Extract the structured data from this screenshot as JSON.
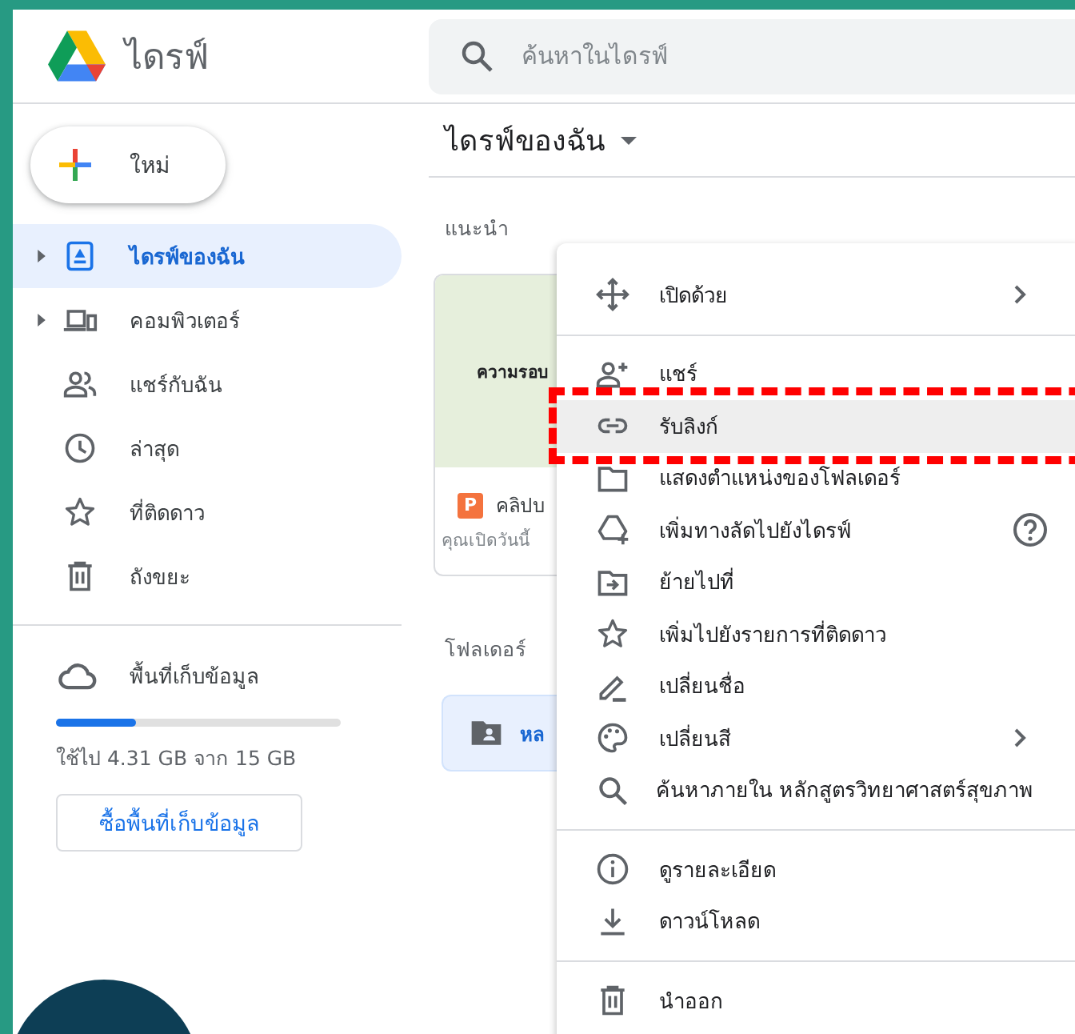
{
  "header": {
    "product_name": "ไดรฟ์",
    "search": {
      "placeholder": "ค้นหาในไดรฟ์"
    }
  },
  "sidebar": {
    "new_button": "ใหม่",
    "items": [
      {
        "label": "ไดรฟ์ของฉัน",
        "kind": "drive",
        "expandable": true,
        "selected": true
      },
      {
        "label": "คอมพิวเตอร์",
        "kind": "computer",
        "expandable": true,
        "selected": false
      },
      {
        "label": "แชร์กับฉัน",
        "kind": "shared",
        "expandable": false,
        "selected": false
      },
      {
        "label": "ล่าสุด",
        "kind": "recent",
        "expandable": false,
        "selected": false
      },
      {
        "label": "ที่ติดดาว",
        "kind": "starred",
        "expandable": false,
        "selected": false
      },
      {
        "label": "ถังขยะ",
        "kind": "trash",
        "expandable": false,
        "selected": false
      }
    ],
    "storage": {
      "label": "พื้นที่เก็บข้อมูล",
      "level": 0.28,
      "usage": "ใช้ไป 4.31 GB จาก 15 GB",
      "buy_button": "ซื้อพื้นที่เก็บข้อมูล"
    }
  },
  "main": {
    "title": "ไดรฟ์ของฉัน",
    "suggested_heading": "แนะนำ",
    "suggested_card": {
      "preview_text": "ความรอบ",
      "file_type": "P",
      "file_name": "คลิปบ",
      "subtitle": "คุณเปิดวันนี้"
    },
    "folders_heading": "โฟลเดอร์",
    "folders": [
      {
        "name": "หล"
      }
    ]
  },
  "context_menu": {
    "sections": [
      [
        {
          "label": "เปิดด้วย",
          "kind": "open_with",
          "submenu": true,
          "help": false,
          "highlighted": false,
          "annotated": false
        }
      ],
      [
        {
          "label": "แชร์",
          "kind": "share",
          "submenu": false,
          "help": false,
          "highlighted": false,
          "annotated": false
        },
        {
          "label": "รับลิงก์",
          "kind": "link",
          "submenu": false,
          "help": false,
          "highlighted": true,
          "annotated": true
        },
        {
          "label": "แสดงตำแหน่งของโฟลเดอร์",
          "kind": "folder",
          "submenu": false,
          "help": false,
          "highlighted": false,
          "annotated": false
        },
        {
          "label": "เพิ่มทางลัดไปยังไดรฟ์",
          "kind": "shortcut",
          "submenu": false,
          "help": true,
          "highlighted": false,
          "annotated": false
        },
        {
          "label": "ย้ายไปที่",
          "kind": "move",
          "submenu": false,
          "help": false,
          "highlighted": false,
          "annotated": false
        },
        {
          "label": "เพิ่มไปยังรายการที่ติดดาว",
          "kind": "star",
          "submenu": false,
          "help": false,
          "highlighted": false,
          "annotated": false
        },
        {
          "label": "เปลี่ยนชื่อ",
          "kind": "rename",
          "submenu": false,
          "help": false,
          "highlighted": false,
          "annotated": false
        },
        {
          "label": "เปลี่ยนสี",
          "kind": "color",
          "submenu": true,
          "help": false,
          "highlighted": false,
          "annotated": false
        },
        {
          "label": "ค้นหาภายใน หลักสูตรวิทยาศาสตร์สุขภาพ",
          "kind": "search",
          "submenu": false,
          "help": false,
          "highlighted": false,
          "annotated": false
        }
      ],
      [
        {
          "label": "ดูรายละเอียด",
          "kind": "info",
          "submenu": false,
          "help": false,
          "highlighted": false,
          "annotated": false
        },
        {
          "label": "ดาวน์โหลด",
          "kind": "download",
          "submenu": false,
          "help": false,
          "highlighted": false,
          "annotated": false
        }
      ],
      [
        {
          "label": "นำออก",
          "kind": "remove",
          "submenu": false,
          "help": false,
          "highlighted": false,
          "annotated": false
        }
      ]
    ]
  }
}
